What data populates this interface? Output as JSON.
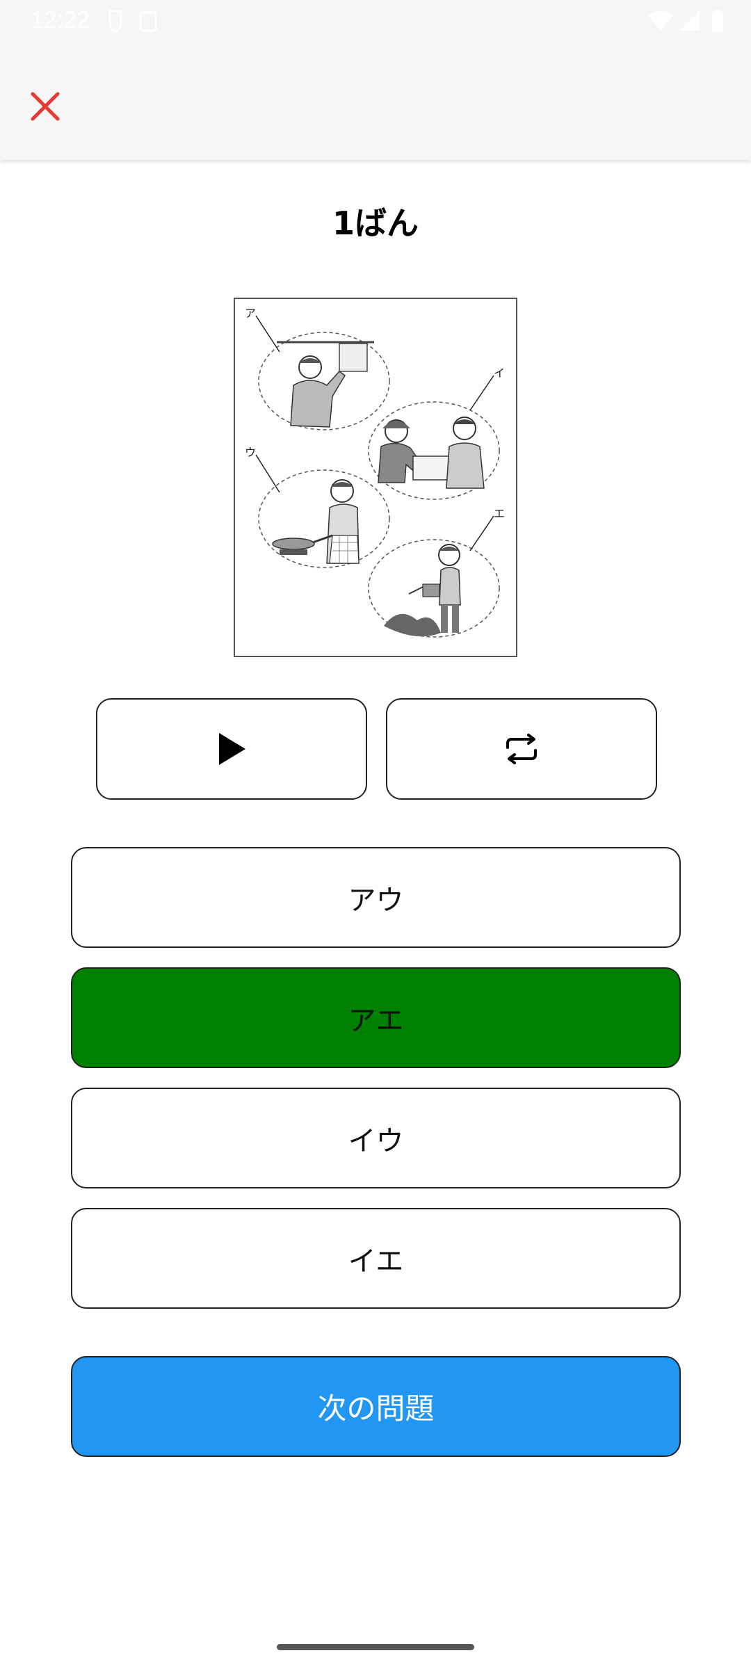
{
  "status_bar": {
    "time": "12:22"
  },
  "header": {
    "title": "1ばん"
  },
  "illustration": {
    "labels": [
      "ア",
      "イ",
      "ウ",
      "エ"
    ]
  },
  "controls": {
    "play_icon": "play-icon",
    "repeat_icon": "repeat-icon"
  },
  "answers": [
    {
      "label": "アウ",
      "state": "default"
    },
    {
      "label": "アエ",
      "state": "correct"
    },
    {
      "label": "イウ",
      "state": "default"
    },
    {
      "label": "イエ",
      "state": "default"
    }
  ],
  "next_button": {
    "label": "次の問題"
  },
  "colors": {
    "correct": "#008000",
    "accent": "#2196f3",
    "close": "#e53935"
  }
}
